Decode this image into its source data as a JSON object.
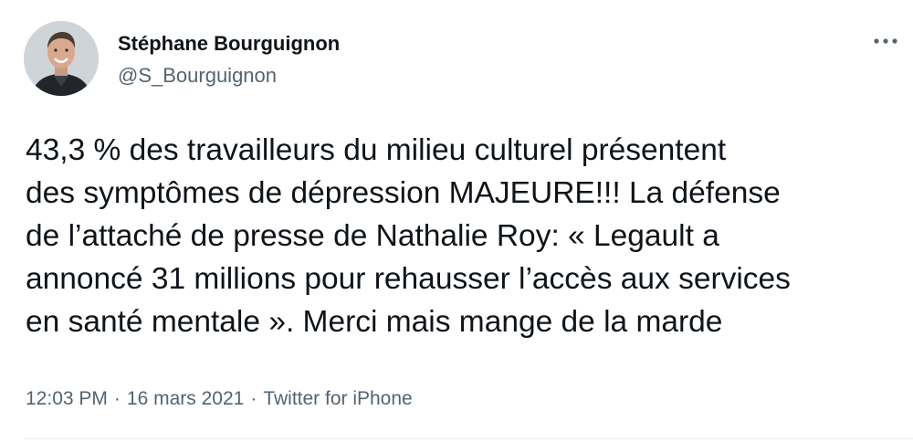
{
  "author": {
    "display_name": "Stéphane Bourguignon",
    "handle": "@S_Bourguignon",
    "avatar_icon": "profile-photo"
  },
  "more_icon": "more-horizontal-icon",
  "tweet": {
    "text": "43,3 % des travailleurs du milieu culturel présentent\ndes symptômes de dépression MAJEURE!!! La défense\nde l’attaché de presse de Nathalie Roy: « Legault a\nannoncé 31 millions pour rehausser l’accès aux services\nen santé mentale ». Merci mais mange de la marde"
  },
  "meta": {
    "time": "12:03 PM",
    "separator": "·",
    "date": "16 mars 2021",
    "source": "Twitter for iPhone"
  },
  "colors": {
    "text": "#0f1419",
    "secondary": "#536471",
    "divider": "#e6ecf0"
  }
}
